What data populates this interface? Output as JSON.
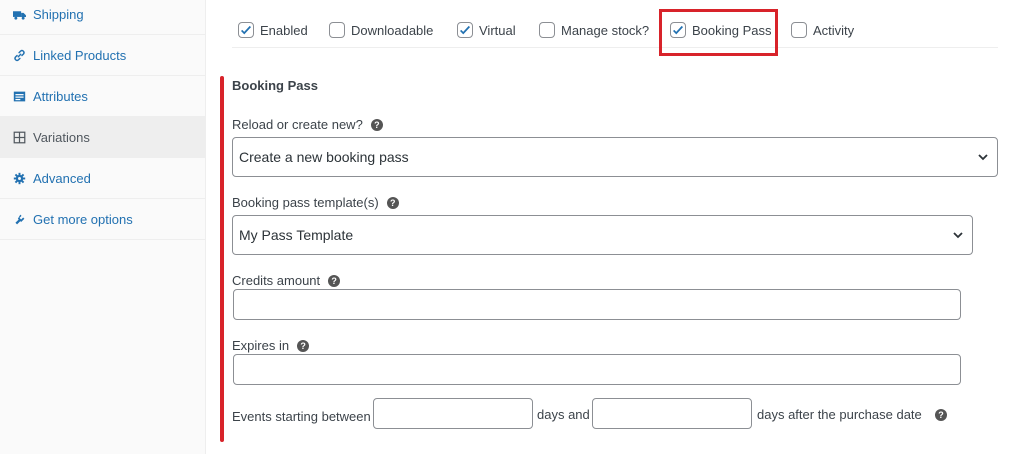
{
  "sidebar": {
    "items": [
      {
        "label": "Shipping",
        "icon": "truck-icon"
      },
      {
        "label": "Linked Products",
        "icon": "link-icon"
      },
      {
        "label": "Attributes",
        "icon": "list-icon"
      },
      {
        "label": "Variations",
        "icon": "grid-icon",
        "active": true
      },
      {
        "label": "Advanced",
        "icon": "gear-icon"
      },
      {
        "label": "Get more options",
        "icon": "plug-icon"
      }
    ]
  },
  "options": {
    "enabled": {
      "label": "Enabled",
      "checked": true
    },
    "downloadable": {
      "label": "Downloadable",
      "checked": false
    },
    "virtual": {
      "label": "Virtual",
      "checked": true
    },
    "manage_stock": {
      "label": "Manage stock?",
      "checked": false
    },
    "booking_pass": {
      "label": "Booking Pass",
      "checked": true
    },
    "activity": {
      "label": "Activity",
      "checked": false
    }
  },
  "booking_pass": {
    "title": "Booking Pass",
    "reload_label": "Reload or create new?",
    "reload_value": "Create a new booking pass",
    "template_label": "Booking pass template(s)",
    "template_value": "My Pass Template",
    "credits_label": "Credits amount",
    "expires_label": "Expires in",
    "events_label": "Events starting between",
    "days_and": "days and",
    "days_after": "days after the purchase date"
  },
  "help_glyph": "?",
  "colors": {
    "link": "#2271b1",
    "highlight": "#d8232a",
    "check": "#2271b1"
  }
}
